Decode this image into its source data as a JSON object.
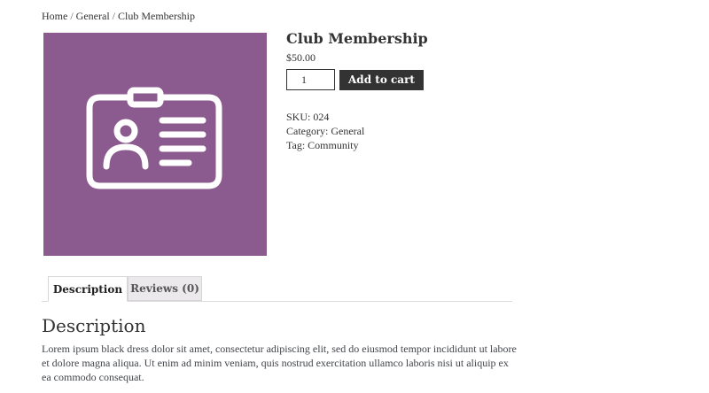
{
  "breadcrumb": {
    "home": "Home",
    "sep1": " / ",
    "category": "General",
    "sep2": " / ",
    "current": "Club Membership"
  },
  "product": {
    "title": "Club Membership",
    "price": "$50.00",
    "image_icon": "id-badge-icon",
    "image_bg": "#8b5a8e"
  },
  "cart": {
    "quantity": "1",
    "add_label": "Add to cart",
    "button_color": "#333333"
  },
  "meta": {
    "sku_label": "SKU: ",
    "sku": "024",
    "category_label": "Category: ",
    "category": "General",
    "tag_label": "Tag: ",
    "tag": "Community"
  },
  "tabs": {
    "description": "Description",
    "reviews": "Reviews (0)"
  },
  "panel": {
    "heading": "Description",
    "body": "Lorem ipsum black dress dolor sit amet, consectetur adipiscing elit, sed do eiusmod tempor incididunt ut labore et dolore magna aliqua. Ut enim ad minim veniam, quis nostrud exercitation ullamco laboris nisi ut aliquip ex ea commodo consequat."
  }
}
